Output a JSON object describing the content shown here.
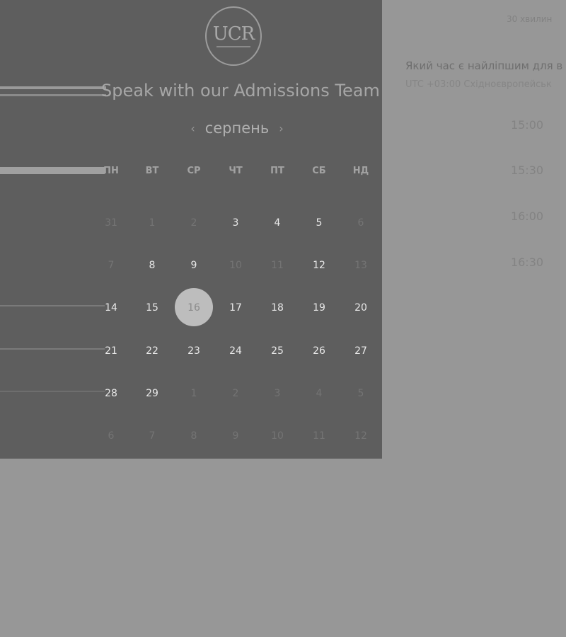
{
  "header": {
    "logo_text": "UCR",
    "title": "Speak with our Admissions Team",
    "duration": "30 хвилин"
  },
  "calendar": {
    "month": "серпень",
    "prev_icon": "chevron-left-icon",
    "next_icon": "chevron-right-icon",
    "weekdays": [
      "ПН",
      "ВТ",
      "СР",
      "ЧТ",
      "ПТ",
      "СБ",
      "НД"
    ],
    "weeks": [
      [
        {
          "d": "31",
          "m": true
        },
        {
          "d": "1",
          "m": true
        },
        {
          "d": "2",
          "m": true
        },
        {
          "d": "3"
        },
        {
          "d": "4"
        },
        {
          "d": "5"
        },
        {
          "d": "6",
          "m": true
        }
      ],
      [
        {
          "d": "7",
          "m": true
        },
        {
          "d": "8"
        },
        {
          "d": "9"
        },
        {
          "d": "10",
          "m": true
        },
        {
          "d": "11",
          "m": true
        },
        {
          "d": "12"
        },
        {
          "d": "13",
          "m": true
        }
      ],
      [
        {
          "d": "14"
        },
        {
          "d": "15"
        },
        {
          "d": "16",
          "s": true
        },
        {
          "d": "17"
        },
        {
          "d": "18"
        },
        {
          "d": "19"
        },
        {
          "d": "20"
        }
      ],
      [
        {
          "d": "21"
        },
        {
          "d": "22"
        },
        {
          "d": "23"
        },
        {
          "d": "24"
        },
        {
          "d": "25"
        },
        {
          "d": "26"
        },
        {
          "d": "27"
        }
      ],
      [
        {
          "d": "28"
        },
        {
          "d": "29"
        },
        {
          "d": "1",
          "m": true
        },
        {
          "d": "2",
          "m": true
        },
        {
          "d": "3",
          "m": true
        },
        {
          "d": "4",
          "m": true
        },
        {
          "d": "5",
          "m": true
        }
      ],
      [
        {
          "d": "6",
          "m": true
        },
        {
          "d": "7",
          "m": true
        },
        {
          "d": "8",
          "m": true
        },
        {
          "d": "9",
          "m": true
        },
        {
          "d": "10",
          "m": true
        },
        {
          "d": "11",
          "m": true
        },
        {
          "d": "12",
          "m": true
        }
      ]
    ],
    "selected_day": "16"
  },
  "times": {
    "question": "Який час є найліпшим для в",
    "timezone": "UTC +03:00 Східноєвропейськ",
    "slots": [
      "15:00",
      "15:30",
      "16:00",
      "16:30"
    ]
  }
}
